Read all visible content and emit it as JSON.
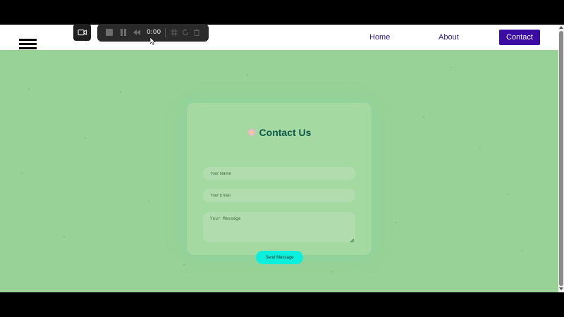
{
  "navbar": {
    "menu_icon": "hamburger-menu-icon",
    "links": [
      {
        "label": "Home"
      },
      {
        "label": "About"
      },
      {
        "label": "Contact",
        "active": true
      }
    ],
    "active_color": "#3a0ca3",
    "link_color": "#2a1a8e"
  },
  "recorder": {
    "camera_icon": "video-camera-icon",
    "time": "0:00",
    "icons": [
      "stop-icon",
      "pause-icon",
      "rewind-icon",
      "grid-icon",
      "restart-icon",
      "trash-icon"
    ]
  },
  "contact_form": {
    "title": "Contact Us",
    "title_icon": "flower-icon",
    "name_placeholder": "Your Name",
    "email_placeholder": "Your Email",
    "message_placeholder": "Your Message",
    "submit_label": "Send Message",
    "submit_color": "#0af0dc",
    "background_color": "#98d296"
  }
}
